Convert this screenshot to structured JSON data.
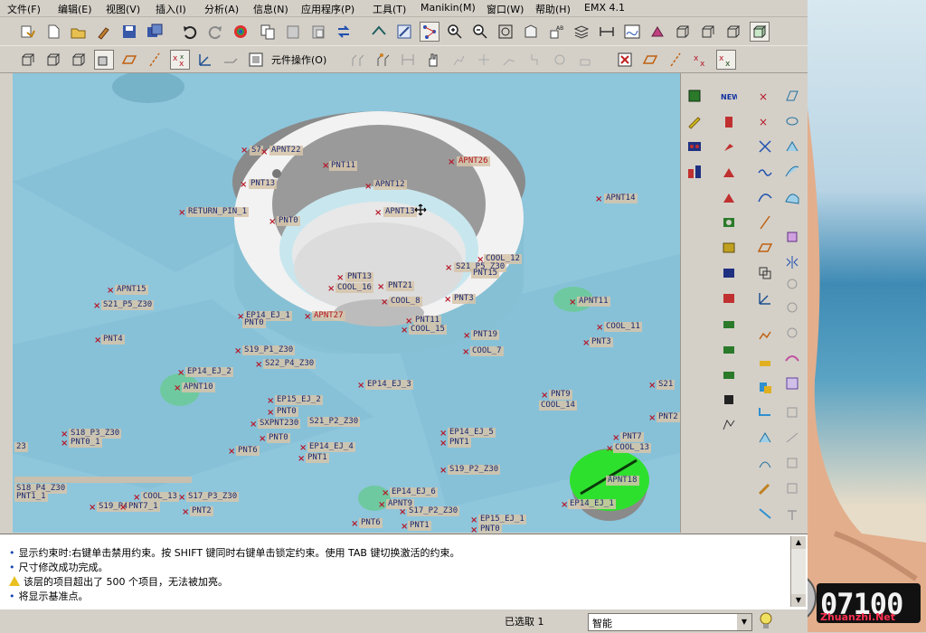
{
  "menu": [
    {
      "id": "file",
      "label": "文件(F)"
    },
    {
      "id": "edit",
      "label": "编辑(E)"
    },
    {
      "id": "view",
      "label": "视图(V)"
    },
    {
      "id": "insert",
      "label": "插入(I)"
    },
    {
      "id": "analysis",
      "label": "分析(A)"
    },
    {
      "id": "info",
      "label": "信息(N)"
    },
    {
      "id": "applications",
      "label": "应用程序(P)"
    },
    {
      "id": "tools",
      "label": "工具(T)"
    },
    {
      "id": "manikin",
      "label": "Manikin(M)"
    },
    {
      "id": "window",
      "label": "窗口(W)"
    },
    {
      "id": "help",
      "label": "帮助(H)"
    },
    {
      "id": "emx",
      "label": "EMX 4.1"
    }
  ],
  "toolbar2": {
    "component_ops_label": "元件操作(O)"
  },
  "datum_points": [
    {
      "label": "APNT22",
      "red": false
    },
    {
      "label": "S7",
      "red": false
    },
    {
      "label": "PNT11",
      "red": false
    },
    {
      "label": "APNT26",
      "red": true
    },
    {
      "label": "PNT13",
      "red": false
    },
    {
      "label": "APNT12",
      "red": false
    },
    {
      "label": "APNT14",
      "red": false
    },
    {
      "label": "RETURN_PIN_1",
      "red": false
    },
    {
      "label": "APNT13",
      "red": false
    },
    {
      "label": "PNT0",
      "red": false
    },
    {
      "label": "COOL_12",
      "red": false
    },
    {
      "label": "S21_P5_Z30",
      "red": false
    },
    {
      "label": "PNT15",
      "red": false
    },
    {
      "label": "APNT15",
      "red": false
    },
    {
      "label": "PNT13",
      "red": false
    },
    {
      "label": "COOL_16",
      "red": false
    },
    {
      "label": "PNT21",
      "red": false
    },
    {
      "label": "S21_P5_Z30",
      "red": false
    },
    {
      "label": "COOL_8",
      "red": false
    },
    {
      "label": "PNT3",
      "red": false
    },
    {
      "label": "APNT11",
      "red": false
    },
    {
      "label": "EP14_EJ_1",
      "red": false
    },
    {
      "label": "PNT0",
      "red": false
    },
    {
      "label": "APNT27",
      "red": true
    },
    {
      "label": "PNT11",
      "red": false
    },
    {
      "label": "COOL_15",
      "red": false
    },
    {
      "label": "COOL_11",
      "red": false
    },
    {
      "label": "PNT4",
      "red": false
    },
    {
      "label": "PNT19",
      "red": false
    },
    {
      "label": "PNT3",
      "red": false
    },
    {
      "label": "S19_P1_Z30",
      "red": false
    },
    {
      "label": "COOL_7",
      "red": false
    },
    {
      "label": "S22_P4_Z30",
      "red": false
    },
    {
      "label": "EP14_EJ_2",
      "red": false
    },
    {
      "label": "APNT10",
      "red": false
    },
    {
      "label": "EP14_EJ_3",
      "red": false
    },
    {
      "label": "S21",
      "red": false
    },
    {
      "label": "PNT9",
      "red": false
    },
    {
      "label": "COOL_14",
      "red": false
    },
    {
      "label": "EP15_EJ_2",
      "red": false
    },
    {
      "label": "PNT0",
      "red": false
    },
    {
      "label": "PNT2",
      "red": false
    },
    {
      "label": "SXPNT230",
      "red": false
    },
    {
      "label": "S21_P2_Z30",
      "red": false
    },
    {
      "label": "S18_P3_Z30",
      "red": false
    },
    {
      "label": "EP14_EJ_5",
      "red": false
    },
    {
      "label": "PNT7",
      "red": false
    },
    {
      "label": "PNT0_1",
      "red": false
    },
    {
      "label": "PNT0",
      "red": false
    },
    {
      "label": "PNT1",
      "red": false
    },
    {
      "label": "COOL_13",
      "red": false
    },
    {
      "label": "PNT6",
      "red": false
    },
    {
      "label": "EP14_EJ_4",
      "red": false
    },
    {
      "label": "23",
      "red": false
    },
    {
      "label": "PNT1",
      "red": false
    },
    {
      "label": "S19_P2_Z30",
      "red": false
    },
    {
      "label": "APNT18",
      "red": false
    },
    {
      "label": "S18_P4_Z30",
      "red": false
    },
    {
      "label": "EP14_EJ_6",
      "red": false
    },
    {
      "label": "PNT1_1",
      "red": false
    },
    {
      "label": "COOL_13",
      "red": false
    },
    {
      "label": "S17_P3_Z30",
      "red": false
    },
    {
      "label": "EP14_EJ_1",
      "red": false
    },
    {
      "label": "S19_P4",
      "red": false
    },
    {
      "label": "PNT7_1",
      "red": false
    },
    {
      "label": "APNT9",
      "red": false
    },
    {
      "label": "PNT2",
      "red": false
    },
    {
      "label": "S17_P2_Z30",
      "red": false
    },
    {
      "label": "EP15_EJ_1",
      "red": false
    },
    {
      "label": "PNT6",
      "red": false
    },
    {
      "label": "PNT1",
      "red": false
    },
    {
      "label": "PNT0",
      "red": false
    }
  ],
  "messages": [
    {
      "icon": "bullet",
      "text": "显示约束时:右键单击禁用约束。按 SHIFT 键同时右键单击锁定约束。使用 TAB 键切换激活的约束。"
    },
    {
      "icon": "bullet",
      "text": "尺寸修改成功完成。"
    },
    {
      "icon": "warning",
      "text": "该层的项目超出了 500 个项目，无法被加亮。"
    },
    {
      "icon": "bullet",
      "text": "将显示基准点。"
    }
  ],
  "status": {
    "selected": "已选取 1",
    "filter_value": "智能"
  },
  "watermark": {
    "clock": "07100",
    "site": "Zhuanzhi.Net"
  },
  "colors": {
    "viewport_bg": "#8ec6dc",
    "datum_red": "#b51828",
    "label_bg": "#d6c4aa",
    "ui_gray": "#d4d0c8",
    "green": "#2ee02e"
  }
}
